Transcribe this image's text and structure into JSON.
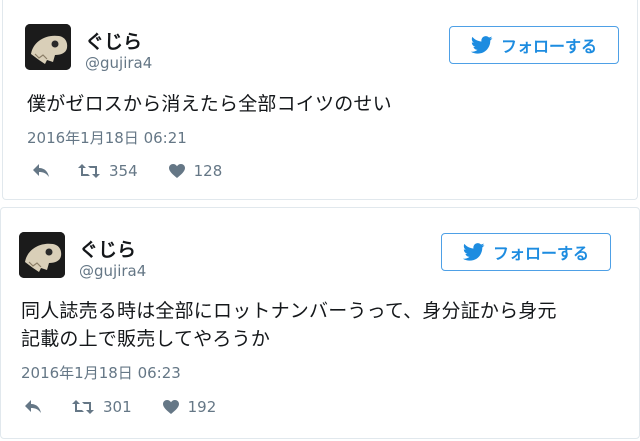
{
  "follow_label": "フォローする",
  "tweets": [
    {
      "name": "ぐじら",
      "handle": "@gujira4",
      "text_lines": [
        "僕がゼロスから消えたら全部コイツのせい"
      ],
      "timestamp": "2016年1月18日 06:21",
      "retweets": "354",
      "likes": "128"
    },
    {
      "name": "ぐじら",
      "handle": "@gujira4",
      "text_lines": [
        "同人誌売る時は全部にロットナンバーうって、身分証から身元",
        "記載の上で販売してやろうか"
      ],
      "timestamp": "2016年1月18日 06:23",
      "retweets": "301",
      "likes": "192"
    }
  ],
  "colors": {
    "accent": "#1d8ce0",
    "text": "#14171a",
    "muted": "#657786",
    "border": "#e1e8ed"
  },
  "icons": {
    "avatar": "skull-avatar",
    "follow": "twitter-bird-icon",
    "reply": "reply-icon",
    "retweet": "retweet-icon",
    "like": "heart-icon"
  }
}
